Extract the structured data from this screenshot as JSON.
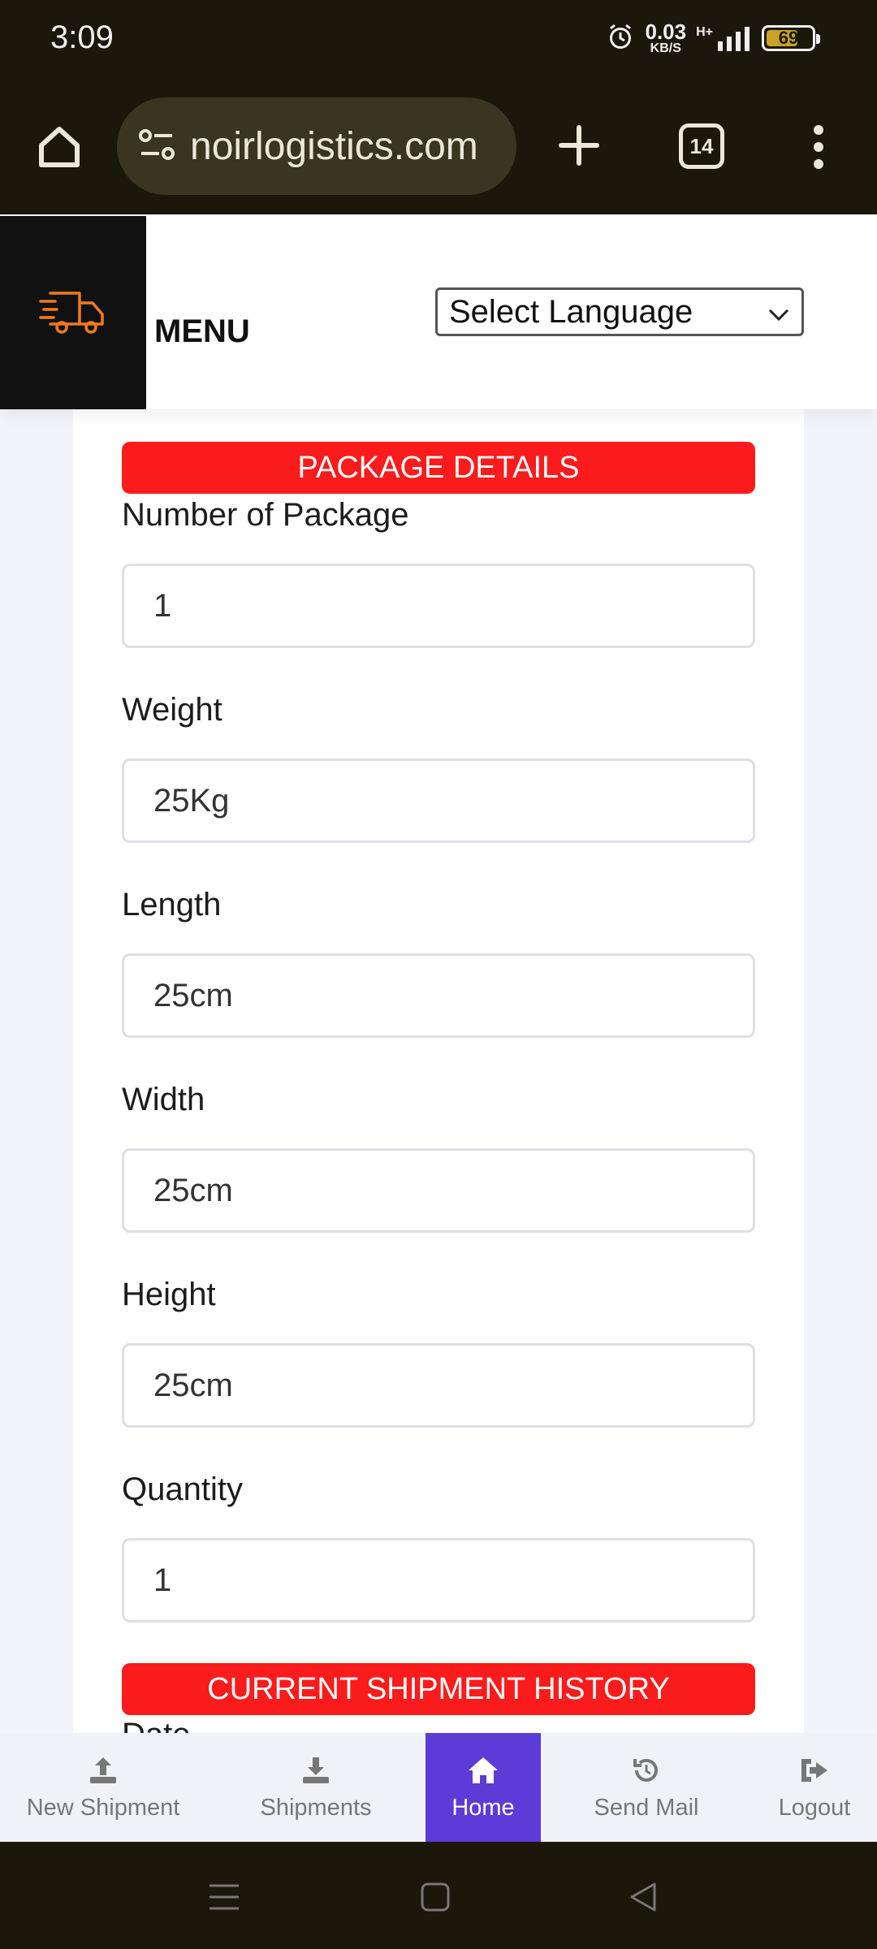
{
  "status_bar": {
    "time": "3:09",
    "net_speed_value": "0.03",
    "net_speed_unit": "KB/S",
    "network_type": "H+",
    "battery": "69"
  },
  "browser": {
    "url": "noirlogistics.com",
    "tab_count": "14"
  },
  "header": {
    "menu_label": "MENU",
    "language_select": "Select Language"
  },
  "form": {
    "package_section_title": "PACKAGE DETAILS",
    "fields": [
      {
        "label": "Number of Package",
        "value": "1"
      },
      {
        "label": "Weight",
        "value": "25Kg"
      },
      {
        "label": "Length",
        "value": "25cm"
      },
      {
        "label": "Width",
        "value": "25cm"
      },
      {
        "label": "Height",
        "value": "25cm"
      },
      {
        "label": "Quantity",
        "value": "1"
      }
    ],
    "history_section_title": "CURRENT SHIPMENT HISTORY",
    "cut_off_label": "Date"
  },
  "bottom_nav": {
    "items": [
      {
        "label": "New Shipment",
        "icon": "upload-icon"
      },
      {
        "label": "Shipments",
        "icon": "download-icon"
      },
      {
        "label": "Home",
        "icon": "home-icon",
        "active": true
      },
      {
        "label": "Send Mail",
        "icon": "history-icon"
      },
      {
        "label": "Logout",
        "icon": "logout-icon"
      }
    ]
  },
  "colors": {
    "accent_red": "#fa1c1c",
    "nav_active": "#5b3cd6",
    "logo_orange": "#f07a22",
    "chrome_bg": "#1a170b"
  }
}
